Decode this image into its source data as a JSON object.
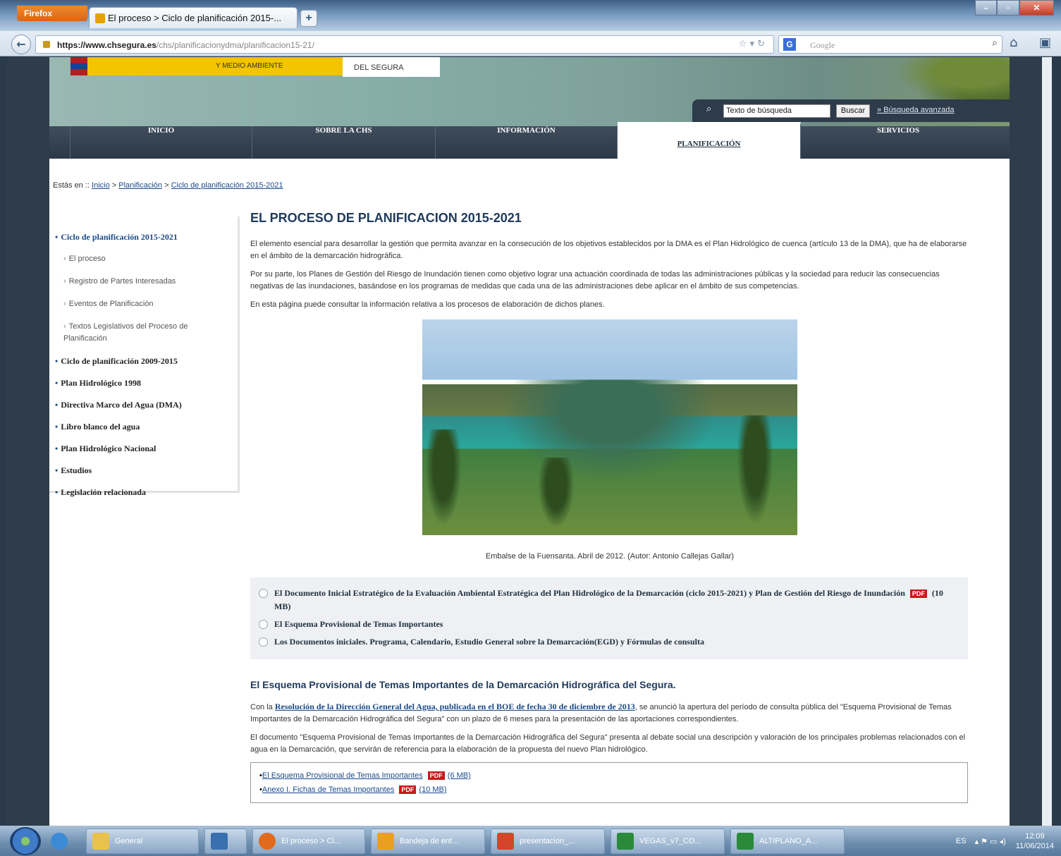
{
  "browser": {
    "app_button": "Firefox",
    "tab_title": "El proceso > Ciclo de planificación 2015-...",
    "new_tab": "+",
    "url_domain": "https://www.chsegura.es",
    "url_path": "/chs/planificacionydma/planificacion15-21/",
    "search_placeholder": "Google",
    "search_engine": "G"
  },
  "site": {
    "ministry_text": "Y MEDIO AMBIENTE",
    "confederation_text": "DEL SEGURA",
    "search_placeholder": "Texto de búsqueda",
    "search_button": "Buscar",
    "advanced_search": "Búsqueda avanzada",
    "nav": [
      "INICIO",
      "SOBRE LA CHS",
      "INFORMACIÓN",
      "PLANIFICACIÓN",
      "SERVICIOS"
    ],
    "breadcrumb_prefix": "Estás en ::",
    "breadcrumb": [
      "Inicio",
      "Planificación",
      "Ciclo de planificación 2015-2021"
    ]
  },
  "sidebar": {
    "active": "Ciclo de planificación 2015-2021",
    "sub": [
      "El proceso",
      "Registro de Partes Interesadas",
      "Eventos de Planificación",
      "Textos Legislativos del Proceso de Planificación"
    ],
    "items": [
      "Ciclo de planificación 2009-2015",
      "Plan Hidrológico 1998",
      "Directiva Marco del Agua (DMA)",
      "Libro blanco del agua",
      "Plan Hidrológico Nacional",
      "Estudios",
      "Legislación relacionada"
    ]
  },
  "content": {
    "title": "EL PROCESO DE PLANIFICACION 2015-2021",
    "p1": "El elemento esencial para desarrollar la gestión que permita avanzar en la consecución de los objetivos establecidos por la DMA es el Plan Hidrológico de cuenca (artículo 13 de la DMA), que ha de elaborarse en el ámbito de la demarcación hidrográfica.",
    "p2": "Por su parte, los Planes de Gestión del Riesgo de Inundación tienen como objetivo lograr una actuación coordinada de todas las administraciones públicas y la sociedad para reducir las consecuencias negativas de las inundaciones, basándose en los programas de medidas que cada una de las administraciones debe aplicar en el ámbito de sus competencias.",
    "p3": "En esta página puede consultar la información relativa a los procesos de elaboración de dichos planes.",
    "caption": "Embalse de la Fuensanta. Abril de 2012. (Autor: Antonio Callejas Gallar)",
    "docs": {
      "d1_a": "El Documento Inicial Estratégico de la Evaluación Ambiental Estratégica del Plan Hidrológico de la Demarcación (ciclo 2015-2021) y Plan de Gestión del Riesgo de Inundación",
      "d1_size": "(10 MB)",
      "d2": "El Esquema Provisional de Temas Importantes",
      "d3": "Los Documentos iniciales. Programa, Calendario, Estudio General sobre la Demarcación(EGD) y Fórmulas de consulta"
    },
    "pdf_label": "PDF",
    "h2": "El Esquema Provisional de Temas Importantes de la Demarcación Hidrográfica del Segura.",
    "p4_a": "Con la",
    "p4_link": "Resolución de la Dirección General del Agua, publicada en el BOE de fecha 30 de diciembre de 2013",
    "p4_b": ", se anunció la apertura del período de consulta pública del \"Esquema Provisional de Temas Importantes de la Demarcación Hidrográfica del Segura\" con un plazo de 6 meses para la presentación de las aportaciones correspondientes.",
    "p5": "El documento \"Esquema Provisional de Temas Importantes de la Demarcación Hidrográfica del Segura\" presenta al debate social una descripción y valoración de los principales problemas relacionados con el agua en la Demarcación, que servirán de referencia para la elaboración de la propuesta del nuevo Plan hidrológico.",
    "links": [
      {
        "text": "El Esquema Provisional de Temas Importantes",
        "size": "(6 MB)"
      },
      {
        "text": "Anexo I. Fichas de Temas Importantes",
        "size": "(10 MB)"
      }
    ]
  },
  "taskbar": {
    "items": [
      "General",
      "",
      "El proceso > Ci...",
      "Bandeja de ent...",
      "presentacion_...",
      "VEGAS_v7_CO...",
      "ALTIPLANO_A..."
    ],
    "lang": "ES",
    "time": "12:09",
    "date": "11/06/2014"
  },
  "colors": {
    "accent": "#1a4a8a",
    "nav_bg": "#2c3846",
    "pdf": "#c81818"
  }
}
